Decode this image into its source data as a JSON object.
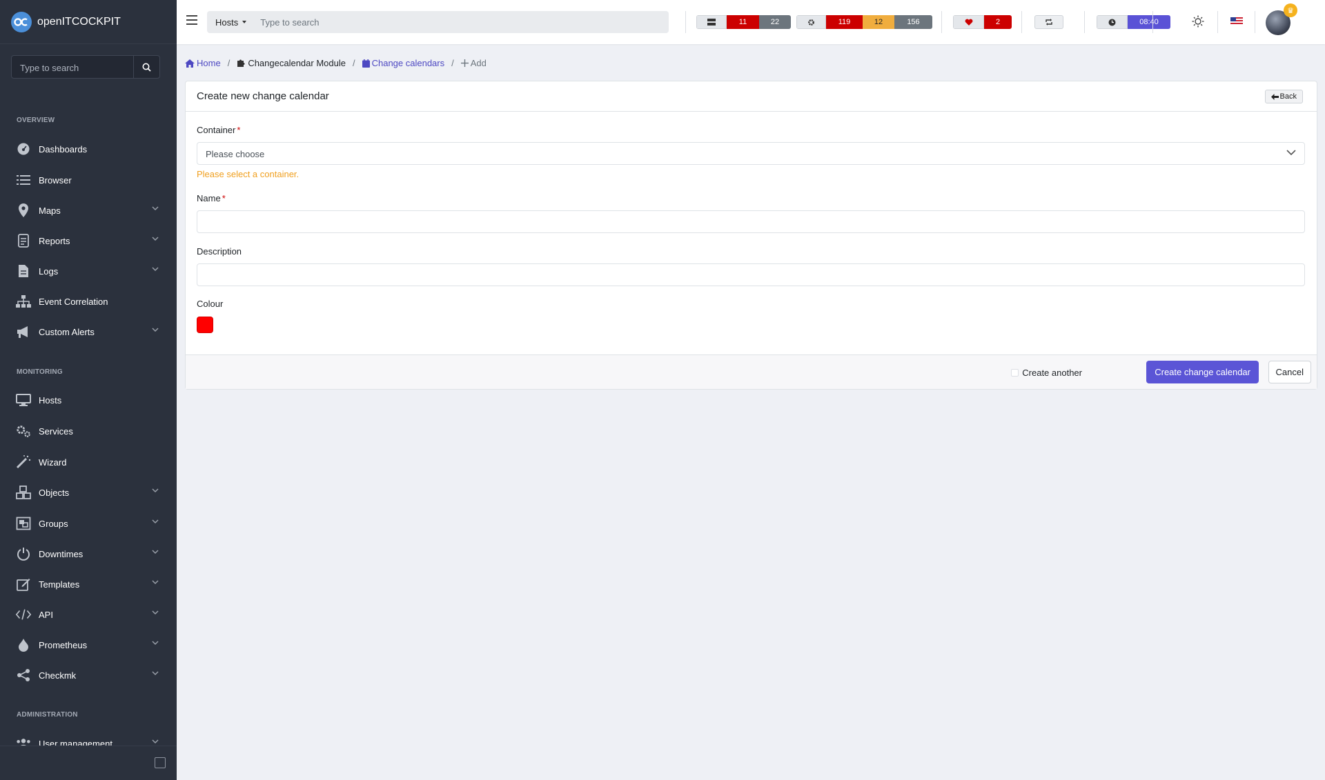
{
  "app": {
    "name": "openITCOCKPIT"
  },
  "sidebar": {
    "search_placeholder": "Type to search",
    "sections": {
      "overview": "OVERVIEW",
      "monitoring": "MONITORING",
      "administration": "ADMINISTRATION"
    },
    "items": [
      {
        "label": "Dashboards",
        "icon": "dashboard-icon",
        "expandable": false
      },
      {
        "label": "Browser",
        "icon": "list-icon",
        "expandable": false
      },
      {
        "label": "Maps",
        "icon": "map-marker-icon",
        "expandable": true
      },
      {
        "label": "Reports",
        "icon": "report-icon",
        "expandable": true
      },
      {
        "label": "Logs",
        "icon": "file-icon",
        "expandable": true
      },
      {
        "label": "Event Correlation",
        "icon": "sitemap-icon",
        "expandable": false
      },
      {
        "label": "Custom Alerts",
        "icon": "bullhorn-icon",
        "expandable": true
      },
      {
        "label": "Hosts",
        "icon": "desktop-icon",
        "expandable": false
      },
      {
        "label": "Services",
        "icon": "gears-icon",
        "expandable": false
      },
      {
        "label": "Wizard",
        "icon": "magic-wand-icon",
        "expandable": false
      },
      {
        "label": "Objects",
        "icon": "cubes-icon",
        "expandable": true
      },
      {
        "label": "Groups",
        "icon": "object-group-icon",
        "expandable": true
      },
      {
        "label": "Downtimes",
        "icon": "power-icon",
        "expandable": true
      },
      {
        "label": "Templates",
        "icon": "edit-icon",
        "expandable": true
      },
      {
        "label": "API",
        "icon": "code-icon",
        "expandable": true
      },
      {
        "label": "Prometheus",
        "icon": "fire-icon",
        "expandable": true
      },
      {
        "label": "Checkmk",
        "icon": "share-icon",
        "expandable": true
      },
      {
        "label": "User management",
        "icon": "users-icon",
        "expandable": true
      }
    ]
  },
  "header": {
    "search_type": "Hosts",
    "search_placeholder": "Type to search",
    "host_stats": {
      "down": "11",
      "unreachable": "22"
    },
    "service_stats": {
      "critical": "119",
      "warning": "12",
      "unknown": "156"
    },
    "system_health": "2",
    "time": "08:40"
  },
  "breadcrumb": {
    "home": "Home",
    "module": "Changecalendar Module",
    "list": "Change calendars",
    "current": "Add"
  },
  "form": {
    "title": "Create new change calendar",
    "back": "Back",
    "container_label": "Container",
    "container_placeholder": "Please choose",
    "container_error": "Please select a container.",
    "name_label": "Name",
    "name_value": "",
    "description_label": "Description",
    "description_value": "",
    "colour_label": "Colour",
    "colour_value": "#ff0000",
    "create_another": "Create another",
    "submit": "Create change calendar",
    "cancel": "Cancel"
  },
  "colors": {
    "accent": "#5b55d6",
    "sidebar_bg": "#2b313d",
    "danger": "#cc0000",
    "warning": "#f0ad3e"
  }
}
